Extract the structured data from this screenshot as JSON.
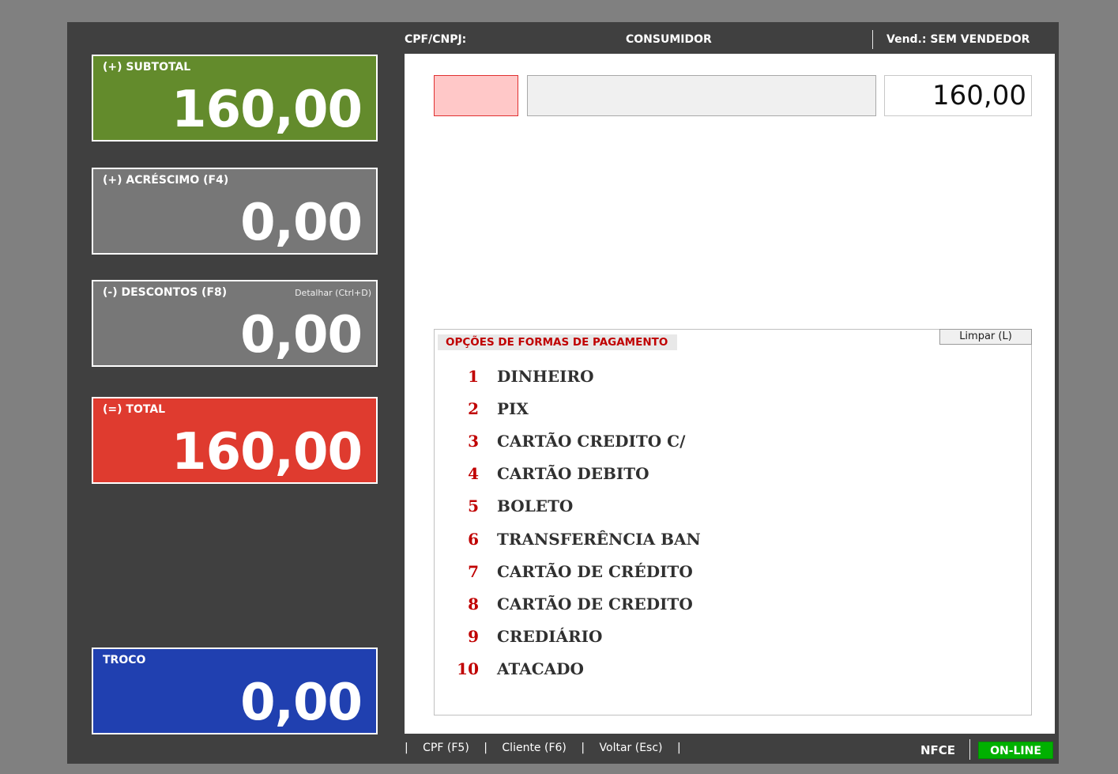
{
  "header": {
    "cpf_label": "CPF/CNPJ:",
    "customer": "CONSUMIDOR",
    "seller": "Vend.:  SEM VENDEDOR"
  },
  "cards": {
    "subtotal": {
      "label": "(+) SUBTOTAL",
      "value": "160,00"
    },
    "acrescimo": {
      "label": "(+) ACRÉSCIMO  (F4)",
      "value": "0,00"
    },
    "descontos": {
      "label": "(-) DESCONTOS (F8)",
      "hint": "Detalhar (Ctrl+D)",
      "value": "0,00"
    },
    "total": {
      "label": "(=) TOTAL",
      "value": "160,00"
    },
    "troco": {
      "label": "TROCO",
      "value": "0,00"
    }
  },
  "payment_input": {
    "code": "",
    "description": "",
    "amount": "160,00"
  },
  "options": {
    "title": "OPÇÕES DE FORMAS DE PAGAMENTO",
    "clear_label": "Limpar (L)",
    "items": [
      {
        "num": "1",
        "name": "DINHEIRO"
      },
      {
        "num": "2",
        "name": "PIX"
      },
      {
        "num": "3",
        "name": "CARTÃO CREDITO C/"
      },
      {
        "num": "4",
        "name": "CARTÃO DEBITO"
      },
      {
        "num": "5",
        "name": "BOLETO"
      },
      {
        "num": "6",
        "name": "TRANSFERÊNCIA BAN"
      },
      {
        "num": "7",
        "name": "CARTÃO DE CRÉDITO"
      },
      {
        "num": "8",
        "name": "CARTÃO DE CREDITO"
      },
      {
        "num": "9",
        "name": "CREDIÁRIO"
      },
      {
        "num": "10",
        "name": "ATACADO"
      }
    ]
  },
  "footer": {
    "sep": "|",
    "cpf": "CPF (F5)",
    "cliente": "Cliente (F6)",
    "voltar": "Voltar (Esc)",
    "doc_type": "NFCE",
    "status": "ON-LINE"
  },
  "colors": {
    "subtotal": "#638b2c",
    "total": "#df3b2f",
    "troco": "#2040b0",
    "status_online": "#00b000",
    "option_number": "#c00000"
  }
}
